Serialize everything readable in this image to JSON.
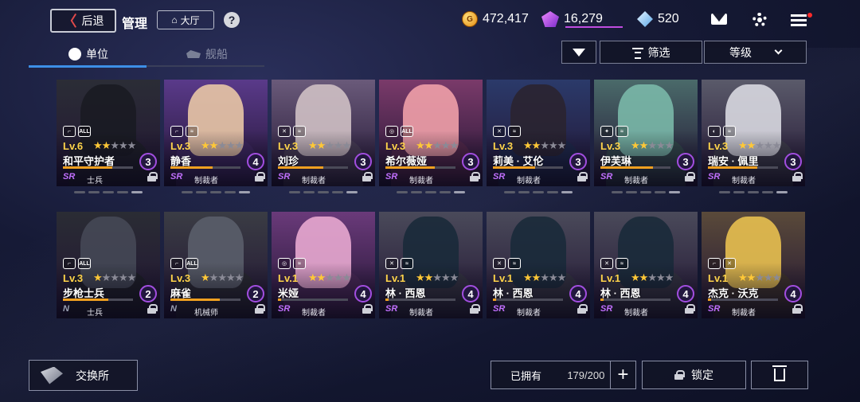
{
  "header": {
    "back_label": "后退",
    "title": "管理",
    "home_label": "大厅",
    "help_label": "?",
    "currencies": [
      {
        "name": "coin",
        "value": "472,417"
      },
      {
        "name": "crystal",
        "value": "16,279"
      },
      {
        "name": "diamond",
        "value": "520"
      }
    ]
  },
  "tabs": [
    {
      "label": "单位",
      "active": true
    },
    {
      "label": "舰船",
      "active": false
    }
  ],
  "controls": {
    "filter_label": "筛选",
    "sort_label": "等级"
  },
  "units": [
    {
      "level": "Lv.6",
      "stars": 2,
      "max_stars": 5,
      "name": "和平守护者",
      "count": "3",
      "rarity": "SR",
      "role": "士兵",
      "icons": [
        "gun",
        "ALL"
      ],
      "bar": 0.7,
      "bg": "#2b2d36",
      "skin": "#1a1b22"
    },
    {
      "level": "Lv.3",
      "stars": 2,
      "max_stars": 5,
      "name": "静香",
      "count": "4",
      "rarity": "SR",
      "role": "制裁者",
      "icons": [
        "gun",
        "wing"
      ],
      "bar": 0.6,
      "bg": "#5a3a8a",
      "skin": "#e9c6a6"
    },
    {
      "level": "Lv.3",
      "stars": 2,
      "max_stars": 5,
      "name": "刘珍",
      "count": "3",
      "rarity": "SR",
      "role": "制裁者",
      "icons": [
        "sword",
        "wing"
      ],
      "bar": 0.65,
      "bg": "#6a5a7a",
      "skin": "#cfc0c4"
    },
    {
      "level": "Lv.3",
      "stars": 2,
      "max_stars": 5,
      "name": "希尔薇娅",
      "count": "3",
      "rarity": "SR",
      "role": "制裁者",
      "icons": [
        "target",
        "ALL"
      ],
      "bar": 0.7,
      "bg": "#7a3a6a",
      "skin": "#f0a0a8"
    },
    {
      "level": "Lv.3",
      "stars": 2,
      "max_stars": 5,
      "name": "莉美 · 艾伦",
      "count": "3",
      "rarity": "SR",
      "role": "制裁者",
      "icons": [
        "sword",
        "wing"
      ],
      "bar": 0.6,
      "bg": "#2b3a6a",
      "skin": "#2a2430"
    },
    {
      "level": "Lv.3",
      "stars": 2,
      "max_stars": 5,
      "name": "伊芙琳",
      "count": "3",
      "rarity": "SR",
      "role": "制裁者",
      "icons": [
        "magic",
        "wing"
      ],
      "bar": 0.75,
      "bg": "#4a6a6a",
      "skin": "#7ab8a8"
    },
    {
      "level": "Lv.3",
      "stars": 2,
      "max_stars": 5,
      "name": "瑞安 · 佩里",
      "count": "3",
      "rarity": "SR",
      "role": "制裁者",
      "icons": [
        "shield",
        "wing"
      ],
      "bar": 0.7,
      "bg": "#5a5a6a",
      "skin": "#d8d8e0"
    },
    {
      "level": "Lv.3",
      "stars": 1,
      "max_stars": 5,
      "name": "步枪士兵",
      "count": "2",
      "rarity": "N",
      "role": "士兵",
      "icons": [
        "gun",
        "ALL"
      ],
      "bar": 0.65,
      "bg": "#2a2c34",
      "skin": "#454855"
    },
    {
      "level": "Lv.3",
      "stars": 1,
      "max_stars": 5,
      "name": "麻雀",
      "count": "2",
      "rarity": "N",
      "role": "机械师",
      "icons": [
        "gun",
        "ALL"
      ],
      "bar": 0.7,
      "bg": "#3a3c44",
      "skin": "#5a5e6a"
    },
    {
      "level": "Lv.1",
      "stars": 2,
      "max_stars": 5,
      "name": "米娅",
      "count": "4",
      "rarity": "SR",
      "role": "制裁者",
      "icons": [
        "target",
        "wing"
      ],
      "bar": 0.05,
      "bg": "#6a3a7a",
      "skin": "#e8a8d0"
    },
    {
      "level": "Lv.1",
      "stars": 2,
      "max_stars": 5,
      "name": "林 · 西恩",
      "count": "4",
      "rarity": "SR",
      "role": "制裁者",
      "icons": [
        "sword",
        "wing"
      ],
      "bar": 0.05,
      "bg": "#4a4a5a",
      "skin": "#1a2a3a"
    },
    {
      "level": "Lv.1",
      "stars": 2,
      "max_stars": 5,
      "name": "林 · 西恩",
      "count": "4",
      "rarity": "SR",
      "role": "制裁者",
      "icons": [
        "sword",
        "wing"
      ],
      "bar": 0.05,
      "bg": "#4a4a5a",
      "skin": "#1a2a3a"
    },
    {
      "level": "Lv.1",
      "stars": 2,
      "max_stars": 5,
      "name": "林 · 西恩",
      "count": "4",
      "rarity": "SR",
      "role": "制裁者",
      "icons": [
        "sword",
        "wing"
      ],
      "bar": 0.05,
      "bg": "#4a4a5a",
      "skin": "#1a2a3a"
    },
    {
      "level": "Lv.1",
      "stars": 2,
      "max_stars": 5,
      "name": "杰克 · 沃克",
      "count": "4",
      "rarity": "SR",
      "role": "制裁者",
      "icons": [
        "gun",
        "sword"
      ],
      "bar": 0.05,
      "bg": "#5a4a3a",
      "skin": "#e8c050"
    }
  ],
  "footer": {
    "exchange_label": "交换所",
    "owned_label": "已拥有",
    "owned_value": "179/200",
    "plus_label": "+",
    "lock_label": "锁定"
  },
  "colors": {
    "accent": "#3d8fe6",
    "sr": "#c270ff",
    "level": "#ffd34a",
    "star": "#ffc837"
  }
}
